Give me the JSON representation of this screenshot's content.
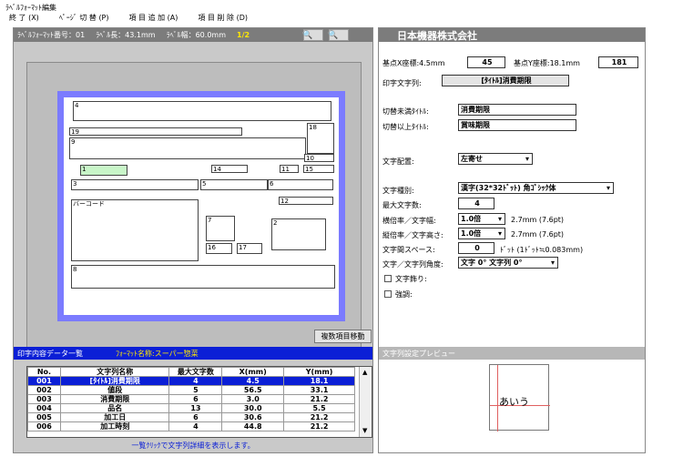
{
  "window": {
    "title": "ﾗﾍﾞﾙﾌｫｰﾏｯﾄ編集"
  },
  "menu": [
    {
      "label": "終 了 (X)"
    },
    {
      "label": "ﾍﾟｰｼﾞ 切 替 (P)"
    },
    {
      "label": "項 目 追 加 (A)"
    },
    {
      "label": "項 目 削 除 (D)"
    }
  ],
  "header": {
    "format_no": "ﾗﾍﾞﾙﾌｫｰﾏｯﾄ番号：01",
    "length": "ﾗﾍﾞﾙ長：43.1mm",
    "width": "ﾗﾍﾞﾙ幅：60.0mm",
    "page": "1/2",
    "zoom_in": "🔍",
    "zoom_out": "🔍"
  },
  "fields": [
    {
      "id": "4",
      "label": "4"
    },
    {
      "id": "19",
      "label": "19"
    },
    {
      "id": "18",
      "label": "18"
    },
    {
      "id": "9",
      "label": "9"
    },
    {
      "id": "10",
      "label": "10"
    },
    {
      "id": "1",
      "label": "1"
    },
    {
      "id": "14",
      "label": "14"
    },
    {
      "id": "11",
      "label": "11"
    },
    {
      "id": "15",
      "label": "15"
    },
    {
      "id": "3",
      "label": "3"
    },
    {
      "id": "5",
      "label": "5"
    },
    {
      "id": "6",
      "label": "6"
    },
    {
      "id": "barcode",
      "label": "バーコード"
    },
    {
      "id": "12",
      "label": "12"
    },
    {
      "id": "7",
      "label": "7"
    },
    {
      "id": "2",
      "label": "2"
    },
    {
      "id": "16",
      "label": "16"
    },
    {
      "id": "17",
      "label": "17"
    },
    {
      "id": "8",
      "label": "8"
    }
  ],
  "multi_move_button": "複数項目移動",
  "list": {
    "title": "印字内容データ一覧",
    "format_name": "ﾌｫｰﾏｯﾄ名称:スーパー惣菜",
    "columns": [
      "No.",
      "文字列名称",
      "最大文字数",
      "X(mm)",
      "Y(mm)"
    ],
    "rows": [
      [
        "001",
        "[ﾀｲﾄﾙ]消費期限",
        "4",
        "4.5",
        "18.1"
      ],
      [
        "002",
        "値段",
        "5",
        "56.5",
        "33.1"
      ],
      [
        "003",
        "消費期限",
        "6",
        "3.0",
        "21.2"
      ],
      [
        "004",
        "品名",
        "13",
        "30.0",
        "5.5"
      ],
      [
        "005",
        "加工日",
        "6",
        "30.6",
        "21.2"
      ],
      [
        "006",
        "加工時刻",
        "4",
        "44.8",
        "21.2"
      ]
    ],
    "footer": "一覧ｸﾘｯｸで文字列詳細を表示します。"
  },
  "right": {
    "company": "日本機器株式会社",
    "x_label": "基点X座標:4.5mm",
    "x_value": "45",
    "y_label": "基点Y座標:18.1mm",
    "y_value": "181",
    "print_label": "印字文字列:",
    "print_value": "[ﾀｲﾄﾙ]消費期限",
    "before_label": "切替未満ﾀｲﾄﾙ:",
    "before_value": "消費期限",
    "after_label": "切替以上ﾀｲﾄﾙ:",
    "after_value": "賞味期限",
    "align_label": "文字配置:",
    "align_value": "左寄せ",
    "type_label": "文字種別:",
    "type_value": "漢字(32*32ﾄﾞｯﾄ) 角ｺﾞｼｯｸ体",
    "max_label": "最大文字数:",
    "max_value": "4",
    "hratio_label": "横倍率／文字幅:",
    "hratio_value": "1.0倍",
    "hratio_note": "2.7mm (7.6pt)",
    "vratio_label": "縦倍率／文字高さ:",
    "vratio_value": "1.0倍",
    "vratio_note": "2.7mm (7.6pt)",
    "space_label": "文字間スペース:",
    "space_value": "0",
    "space_note": "ﾄﾞｯﾄ (1ﾄﾞｯﾄ≒0.083mm)",
    "angle_label": "文字／文字列角度:",
    "angle_value": "文字 0° 文字列 0°",
    "ruby_label": "文字飾り:",
    "emph_label": "強調:",
    "preview_title": "文字列設定プレビュー",
    "preview_text": "あいう"
  }
}
